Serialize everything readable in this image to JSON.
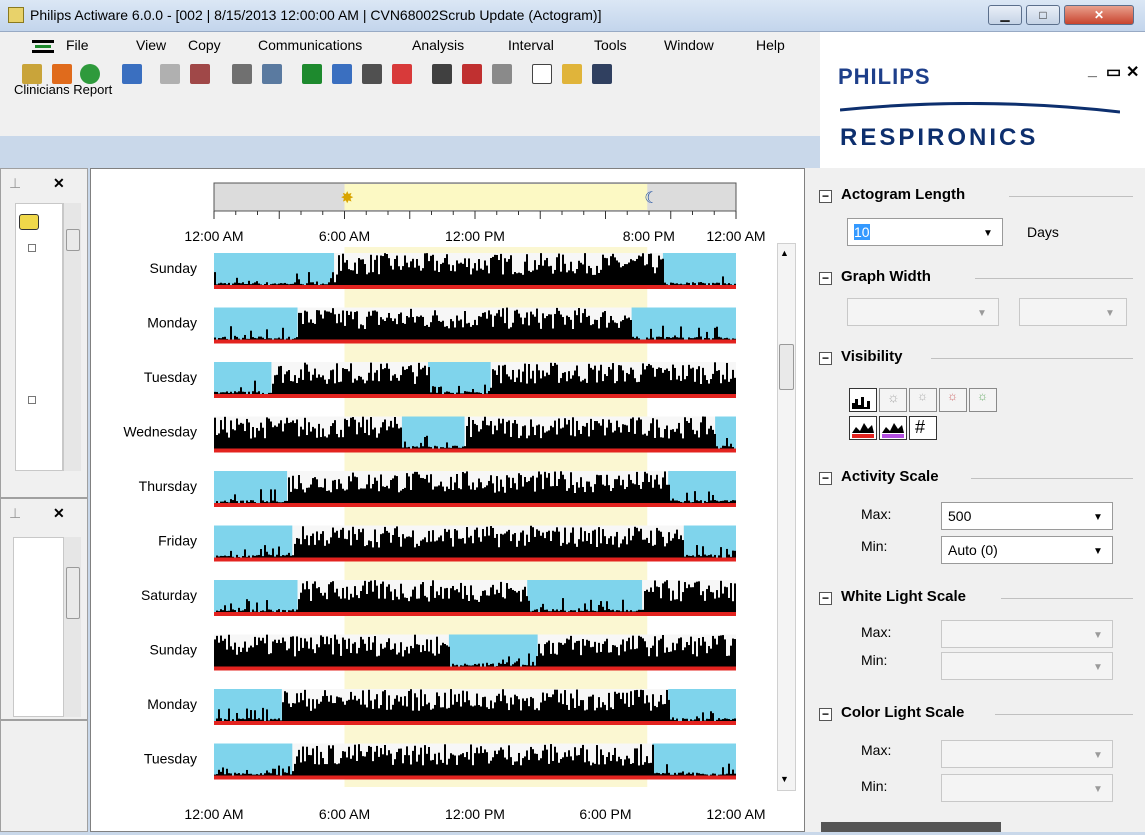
{
  "window": {
    "title": "Philips Actiware 6.0.0 - [002 | 8/15/2013 12:00:00 AM | CVN68002Scrub Update (Actogram)]"
  },
  "menu": [
    "File",
    "View",
    "Copy",
    "Communications",
    "Analysis",
    "Interval",
    "Tools",
    "Window",
    "Help"
  ],
  "toolbar_label": "Clinicians Report",
  "brand": {
    "top": "PHILIPS",
    "bottom": "RESPIRONICS"
  },
  "left": {
    "pin": "⊥",
    "close": "✕"
  },
  "chart": {
    "top_axis": [
      "12:00 AM",
      "6:00 AM",
      "12:00 PM",
      "8:00 PM",
      "12:00 AM"
    ],
    "bottom_axis": [
      "12:00 AM",
      "6:00 AM",
      "12:00 PM",
      "6:00 PM",
      "12:00 AM"
    ],
    "days": [
      "Sunday",
      "Monday",
      "Tuesday",
      "Wednesday",
      "Thursday",
      "Friday",
      "Saturday",
      "Sunday",
      "Monday",
      "Tuesday"
    ]
  },
  "right": {
    "actogram_length": {
      "title": "Actogram Length",
      "value": "10",
      "unit": "Days"
    },
    "graph_width": {
      "title": "Graph Width"
    },
    "visibility": {
      "title": "Visibility"
    },
    "activity_scale": {
      "title": "Activity Scale",
      "max_label": "Max:",
      "max_value": "500",
      "min_label": "Min:",
      "min_value": "Auto (0)"
    },
    "white_light_scale": {
      "title": "White Light Scale",
      "max_label": "Max:",
      "min_label": "Min:"
    },
    "color_light_scale": {
      "title": "Color Light Scale",
      "max_label": "Max:",
      "min_label": "Min:"
    }
  },
  "colors": {
    "sky": "#7fd4ec",
    "activity": "#000000",
    "offwrist": "#e3231f",
    "day_band": "#fbf7d2"
  }
}
